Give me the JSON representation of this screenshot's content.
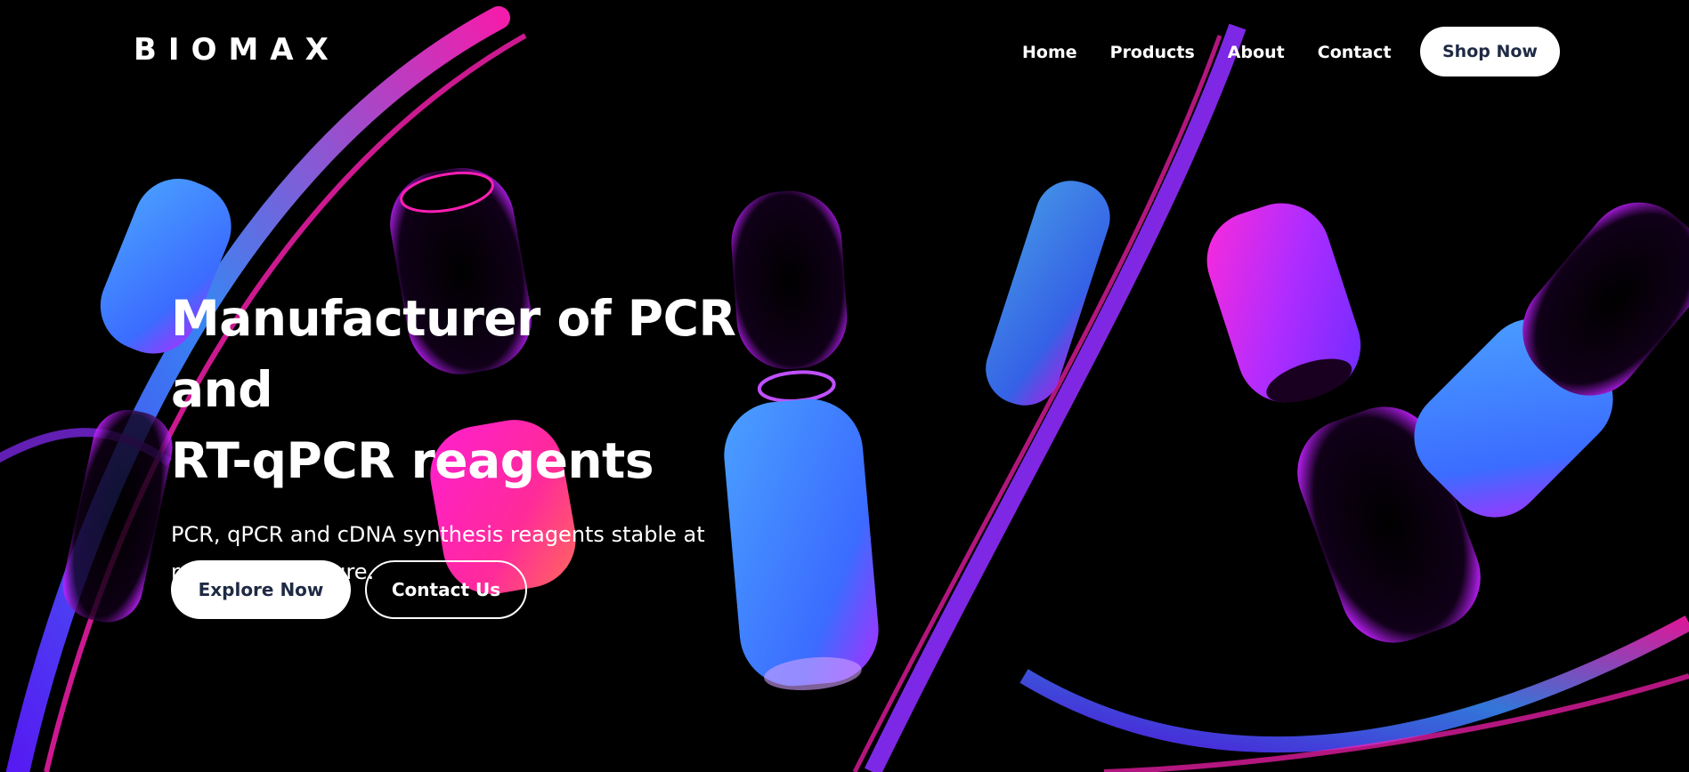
{
  "brand": {
    "logo_text": "BIOMAX"
  },
  "nav": {
    "items": [
      {
        "label": "Home"
      },
      {
        "label": "Products"
      },
      {
        "label": "About"
      },
      {
        "label": "Contact"
      }
    ],
    "cta_label": "Shop Now"
  },
  "hero": {
    "headline_line1": "Manufacturer of PCR and",
    "headline_line2": "RT-qPCR reagents",
    "subtitle": "PCR, qPCR and cDNA synthesis reagents stable at room temperature.",
    "primary_cta": "Explore Now",
    "secondary_cta": "Contact Us"
  },
  "background": {
    "description_icon": "dna-helix-3d-art"
  },
  "colors": {
    "background": "#000000",
    "accent_blue": "#3b8cff",
    "accent_magenta": "#ff1fb4",
    "accent_purple": "#8a2cff",
    "button_bg": "#ffffff",
    "button_text": "#1f2a44"
  }
}
